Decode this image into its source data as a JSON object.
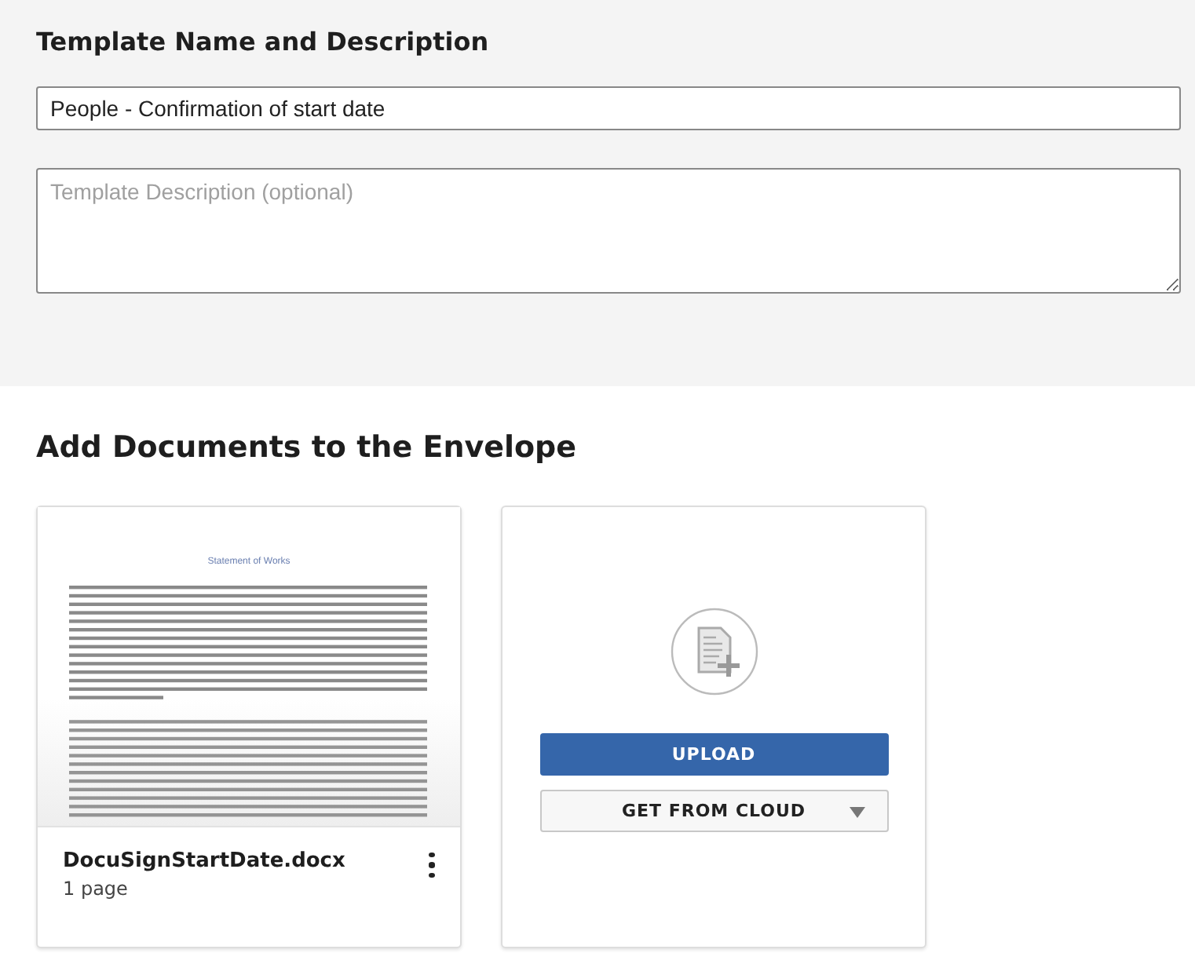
{
  "template_section": {
    "heading": "Template Name and Description",
    "name_field": {
      "value": "People - Confirmation of start date"
    },
    "description_field": {
      "placeholder": "Template Description (optional)"
    }
  },
  "documents_section": {
    "heading": "Add Documents to the Envelope",
    "documents": [
      {
        "preview_title": "Statement of Works",
        "filename": "DocuSignStartDate.docx",
        "pages": "1 page"
      }
    ],
    "upload_card": {
      "upload_button": "UPLOAD",
      "cloud_button": "GET FROM CLOUD"
    }
  }
}
